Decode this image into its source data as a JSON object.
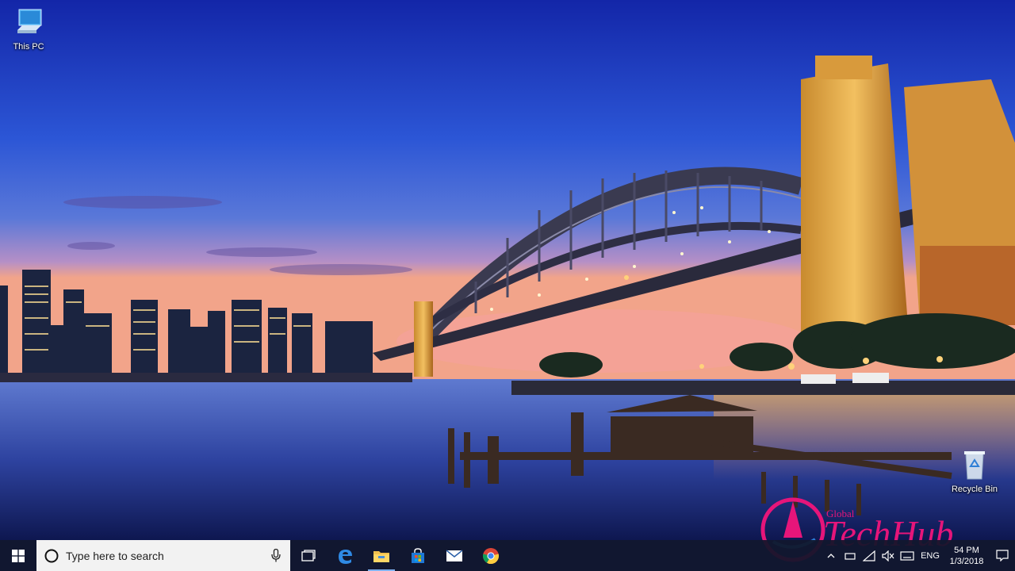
{
  "desktop": {
    "icons": [
      {
        "label": "This PC",
        "icon": "this-pc-icon"
      },
      {
        "label": "Recycle Bin",
        "icon": "recycle-bin-icon"
      }
    ]
  },
  "taskbar": {
    "search": {
      "placeholder": "Type here to search"
    },
    "pinned": [
      {
        "name": "task-view",
        "icon": "task-view-icon"
      },
      {
        "name": "edge",
        "icon": "edge-icon"
      },
      {
        "name": "file-explorer",
        "icon": "folder-icon"
      },
      {
        "name": "store",
        "icon": "store-icon"
      },
      {
        "name": "mail",
        "icon": "mail-icon"
      },
      {
        "name": "chrome",
        "icon": "chrome-icon"
      }
    ],
    "tray": {
      "language": "ENG",
      "time": "54 PM",
      "date": "1/3/2018"
    }
  },
  "watermark": {
    "line1": "Global",
    "line2": "TechHub"
  },
  "colors": {
    "taskbar_bg": "#101628",
    "accent": "#7fb2f0",
    "watermark_pink": "#e6157a",
    "watermark_blue": "#2a7bd8"
  }
}
